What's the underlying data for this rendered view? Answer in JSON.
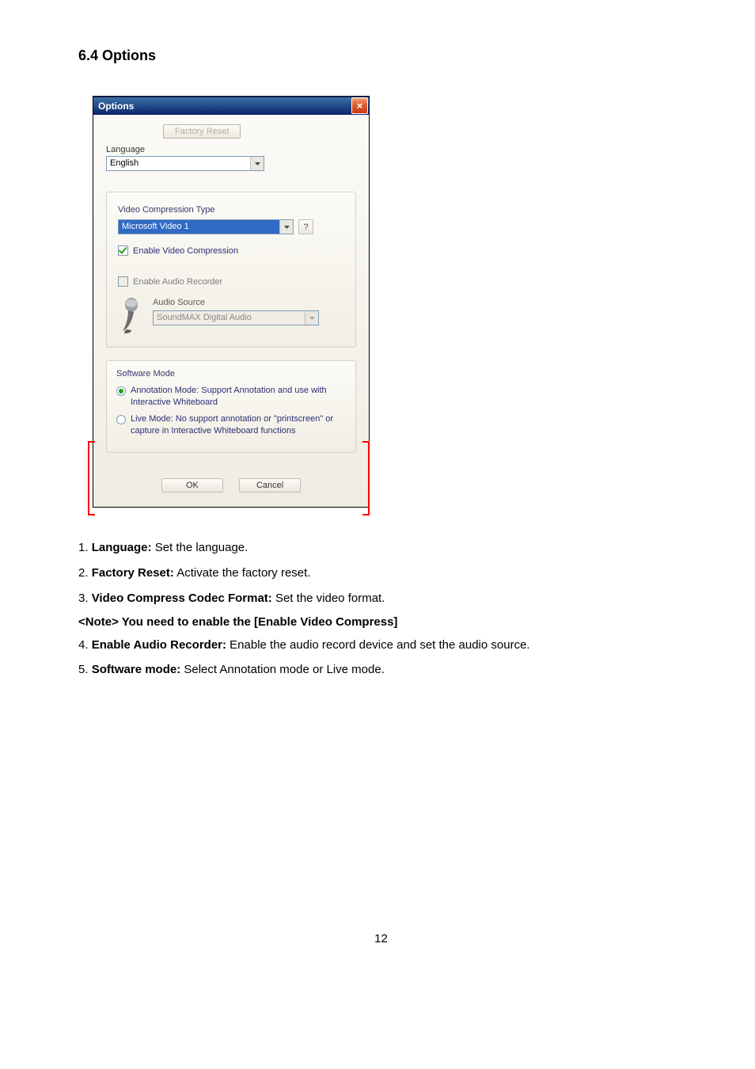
{
  "heading": "6.4 Options",
  "dialog": {
    "title": "Options",
    "close_glyph": "×",
    "factory_reset": "Factory Reset",
    "language_label": "Language",
    "language_value": "English",
    "video": {
      "label": "Video Compression Type",
      "codec": "Microsoft Video 1",
      "help": "?",
      "enable": "Enable Video Compression"
    },
    "audio": {
      "enable": "Enable Audio Recorder",
      "label": "Audio Source",
      "source": "SoundMAX Digital Audio"
    },
    "software": {
      "head": "Software Mode",
      "opt_annotation": "Annotation Mode: Support Annotation and use with Interactive Whiteboard",
      "opt_live": "Live Mode: No support annotation or \"printscreen\" or capture in Interactive Whiteboard functions"
    },
    "ok": "OK",
    "cancel": "Cancel"
  },
  "list": {
    "i1_num": "1. ",
    "i1_b": "Language:",
    "i1_t": " Set the language.",
    "i2_num": "2. ",
    "i2_b": "Factory Reset:",
    "i2_t": " Activate the factory reset.",
    "i3_num": "3. ",
    "i3_b": "Video Compress Codec Format:",
    "i3_t": " Set the video format.",
    "note": "<Note> You need to enable the [Enable Video Compress]",
    "i4_num": "4. ",
    "i4_b": "Enable Audio Recorder:",
    "i4_t": " Enable the audio record device and set the audio source.",
    "i5_num": "5. ",
    "i5_b": "Software mode:",
    "i5_t": " Select Annotation mode or Live mode."
  },
  "page_number": "12"
}
